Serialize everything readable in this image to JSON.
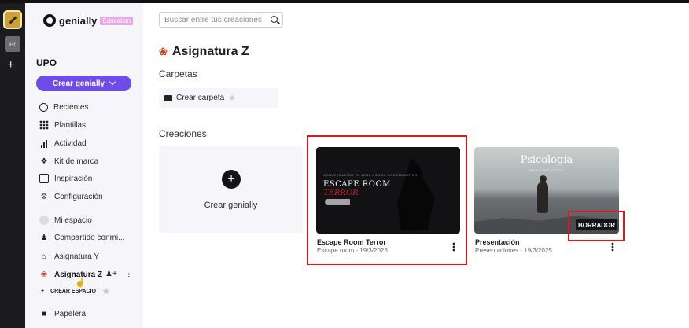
{
  "rail": {
    "second_tile": "Pr"
  },
  "brand": {
    "name": "genially",
    "badge": "Education"
  },
  "workspace": {
    "name": "UPO"
  },
  "create_button": {
    "label": "Crear genially"
  },
  "nav": [
    {
      "label": "Recientes",
      "icon": "clock-icon"
    },
    {
      "label": "Plantillas",
      "icon": "grid-icon"
    },
    {
      "label": "Actividad",
      "icon": "bar-chart-icon"
    },
    {
      "label": "Kit de marca",
      "icon": "brand-kit-icon"
    },
    {
      "label": "Inspiración",
      "icon": "inspiration-icon"
    },
    {
      "label": "Configuración",
      "icon": "gear-icon"
    }
  ],
  "spaces": [
    {
      "label": "Mi espacio",
      "icon": "avatar-icon"
    },
    {
      "label": "Compartido conmi...",
      "icon": "shared-icon"
    },
    {
      "label": "Asignatura Y",
      "icon": "building-icon"
    },
    {
      "label": "Asignatura Z",
      "icon": "maple-leaf-icon"
    }
  ],
  "create_space": {
    "label": "CREAR ESPACIO"
  },
  "trash": {
    "label": "Papelera"
  },
  "search": {
    "placeholder": "Buscar entre tus creaciones"
  },
  "page": {
    "title": "Asignatura Z"
  },
  "folders": {
    "heading": "Carpetas",
    "create_label": "Crear carpeta"
  },
  "creations": {
    "heading": "Creaciones",
    "new_label": "Crear genially",
    "items": [
      {
        "title": "Escape Room Terror",
        "meta": "Escape room - 19/3/2025",
        "thumb_text": {
          "sub": "CONVERSACIÓN TU VERA CON EL CONSTRUCTIVO",
          "line1": "ESCAPE ROOM",
          "line2": "TERROR"
        }
      },
      {
        "title": "Presentación",
        "meta": "Presentaciones - 19/3/2025",
        "badge": "BORRADOR",
        "thumb_text": {
          "title": "Psicología",
          "sub": "PRESENTACIÓN"
        }
      }
    ]
  },
  "colors": {
    "accent": "#6d4ce8",
    "highlight": "#e4141a",
    "badge": "#e9a8e5"
  }
}
